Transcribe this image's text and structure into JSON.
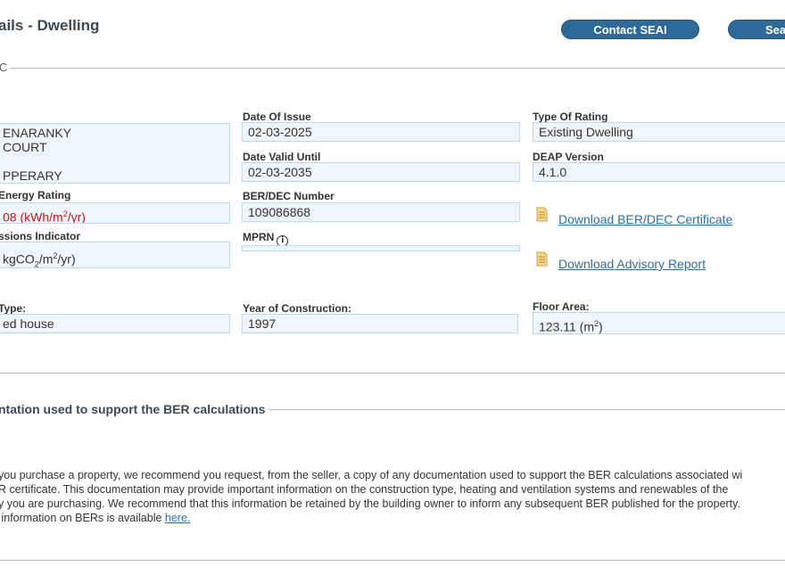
{
  "header": {
    "title": "ails - Dwelling",
    "contact_button": "Contact SEAI",
    "search_button": "Sea"
  },
  "section1": {
    "legend": "C"
  },
  "address": {
    "lines": [
      "ENARANKY",
      "COURT",
      "",
      "PPERARY"
    ]
  },
  "date_of_issue": {
    "label": "Date Of Issue",
    "value": "02-03-2025"
  },
  "type_of_rating": {
    "label": "Type Of Rating",
    "value": "Existing Dwelling"
  },
  "date_valid_until": {
    "label": "Date Valid Until",
    "value": "02-03-2035"
  },
  "deap_version": {
    "label": "DEAP Version",
    "value": "4.1.0"
  },
  "energy_rating": {
    "label": "Energy Rating",
    "value_prefix": "08 (kWh/m",
    "value_sup": "2",
    "value_suffix": "/yr)"
  },
  "ber_number": {
    "label": "BER/DEC Number",
    "value": "109086868"
  },
  "emissions": {
    "label": "ssions Indicator",
    "value_prefix": "kgCO",
    "value_sub": "2",
    "value_mid": "/m",
    "value_sup": "2",
    "value_suffix": "/yr)"
  },
  "mprn": {
    "label": "MPRN",
    "value": ""
  },
  "downloads": {
    "certificate": "Download BER/DEC Certificate",
    "advisory": "Download Advisory Report"
  },
  "dwelling_type": {
    "label": "Type:",
    "value": "ed house"
  },
  "year_of_construction": {
    "label": "Year of Construction:",
    "value": "1997"
  },
  "floor_area": {
    "label": "Floor Area:",
    "value_prefix": "123.11 (m",
    "value_sup": "2",
    "value_suffix": ")"
  },
  "section2": {
    "legend": "ntation used to support the BER calculations",
    "para_lines": [
      "you purchase a property, we recommend you request, from the seller, a copy of any documentation used to support the BER calculations associated wi",
      "R certificate. This documentation may provide important information on the construction type, heating and ventilation systems and renewables of the",
      "y you are purchasing. We recommend that this information be retained by the building owner to inform any subsequent BER published for the property."
    ],
    "last_line_prefix": " information on BERs is available ",
    "link": "here."
  },
  "colors": {
    "button_bg": "#2e6a98",
    "field_bg": "#eef6fc",
    "field_border": "#bcd9ee",
    "rating_red": "#c0181c",
    "link": "#2f6ea2"
  },
  "icons": {
    "document": "document-icon",
    "info": "info-icon"
  }
}
